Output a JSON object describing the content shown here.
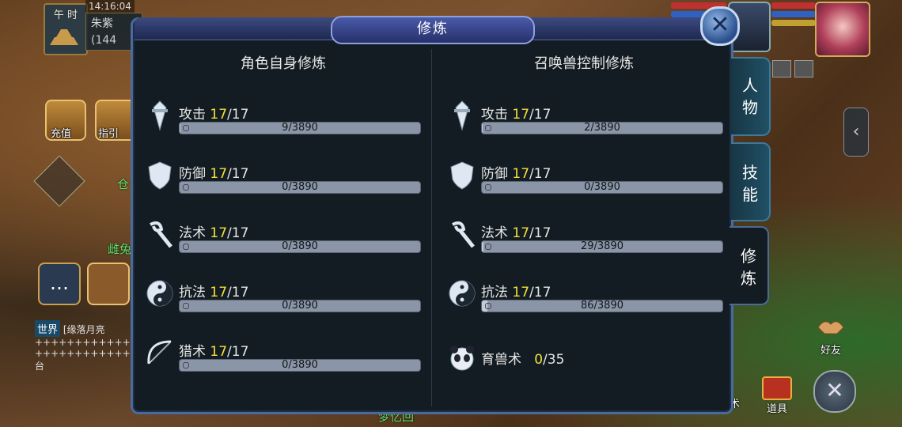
{
  "hud": {
    "time_label": "午 时",
    "clock": "14:16:04",
    "player_name": "朱紫",
    "player_sub": "(144",
    "recharge_label": "充值",
    "guide_label": "指引",
    "green_name_1": "仓",
    "green_name_2": "雌兔",
    "chat_channel": "世界",
    "chat_line_1": "[缘落月亮",
    "chat_line_2": "++++++++++++++++",
    "chat_line_3": "++++++++++++++++",
    "chat_line_4": "台",
    "friend_label": "好友",
    "item_label": "道具",
    "partial_label": "术",
    "bottom_text": "梦忆回"
  },
  "panel": {
    "title": "修炼",
    "close_glyph": "✕",
    "left_title": "角色自身修炼",
    "right_title": "召唤兽控制修炼",
    "tabs": [
      {
        "label_1": "人",
        "label_2": "物",
        "active": false
      },
      {
        "label_1": "技",
        "label_2": "能",
        "active": false
      },
      {
        "label_1": "修",
        "label_2": "炼",
        "active": true
      }
    ],
    "left_rows": [
      {
        "name": "攻击",
        "level": "17",
        "max": "/17",
        "progress": "9/3890",
        "fraction": 0.0023,
        "icon": "sword-icon"
      },
      {
        "name": "防御",
        "level": "17",
        "max": "/17",
        "progress": "0/3890",
        "fraction": 0,
        "icon": "shield-icon"
      },
      {
        "name": "法术",
        "level": "17",
        "max": "/17",
        "progress": "0/3890",
        "fraction": 0,
        "icon": "staff-icon"
      },
      {
        "name": "抗法",
        "level": "17",
        "max": "/17",
        "progress": "0/3890",
        "fraction": 0,
        "icon": "yinyang-icon"
      },
      {
        "name": "猎术",
        "level": "17",
        "max": "/17",
        "progress": "0/3890",
        "fraction": 0,
        "icon": "bow-icon"
      }
    ],
    "right_rows": [
      {
        "name": "攻击",
        "level": "17",
        "max": "/17",
        "progress": "2/3890",
        "fraction": 0.0005,
        "icon": "sword-icon"
      },
      {
        "name": "防御",
        "level": "17",
        "max": "/17",
        "progress": "0/3890",
        "fraction": 0,
        "icon": "shield-icon"
      },
      {
        "name": "法术",
        "level": "17",
        "max": "/17",
        "progress": "29/3890",
        "fraction": 0.0075,
        "icon": "staff-icon"
      },
      {
        "name": "抗法",
        "level": "17",
        "max": "/17",
        "progress": "86/3890",
        "fraction": 0.022,
        "icon": "yinyang-icon"
      }
    ],
    "beast_row": {
      "name": "育兽术",
      "level": "0",
      "max": "/35",
      "icon": "panda-icon"
    }
  }
}
